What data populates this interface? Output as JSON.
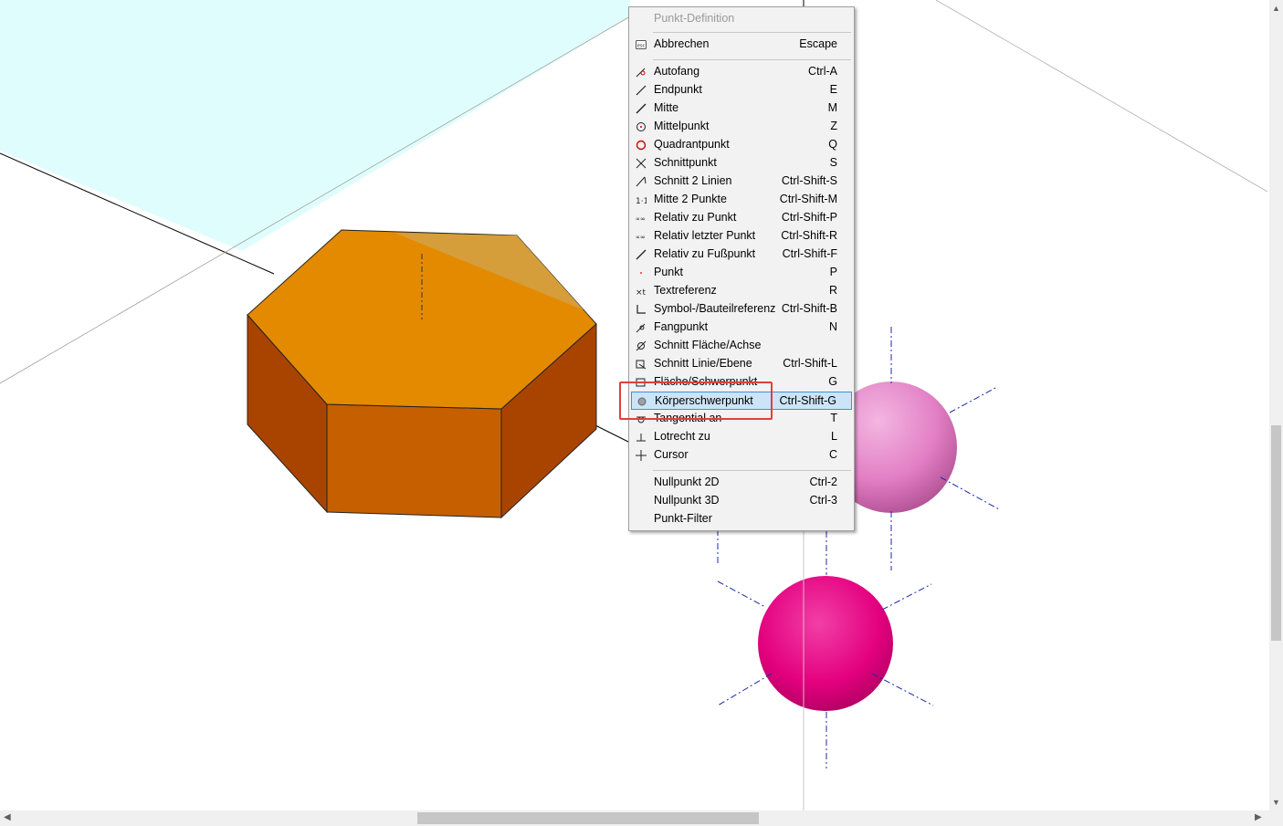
{
  "menu": {
    "header": "Punkt-Definition",
    "items": [
      {
        "label": "Abbrechen",
        "shortcut": "Escape",
        "icon": "esc-icon"
      },
      {
        "label": "Autofang",
        "shortcut": "Ctrl-A",
        "icon": "autosnap-icon"
      },
      {
        "label": "Endpunkt",
        "shortcut": "E",
        "icon": "endpoint-icon"
      },
      {
        "label": "Mitte",
        "shortcut": "M",
        "icon": "midpoint-icon"
      },
      {
        "label": "Mittelpunkt",
        "shortcut": "Z",
        "icon": "center-icon"
      },
      {
        "label": "Quadrantpunkt",
        "shortcut": "Q",
        "icon": "quadrant-icon"
      },
      {
        "label": "Schnittpunkt",
        "shortcut": "S",
        "icon": "intersection-icon"
      },
      {
        "label": "Schnitt 2 Linien",
        "shortcut": "Ctrl-Shift-S",
        "icon": "intersect-two-lines-icon"
      },
      {
        "label": "Mitte 2 Punkte",
        "shortcut": "Ctrl-Shift-M",
        "icon": "mid-two-points-icon"
      },
      {
        "label": "Relativ zu Punkt",
        "shortcut": "Ctrl-Shift-P",
        "icon": "relative-point-icon"
      },
      {
        "label": "Relativ letzter Punkt",
        "shortcut": "Ctrl-Shift-R",
        "icon": "relative-last-point-icon"
      },
      {
        "label": "Relativ zu Fußpunkt",
        "shortcut": "Ctrl-Shift-F",
        "icon": "relative-foot-point-icon"
      },
      {
        "label": "Punkt",
        "shortcut": "P",
        "icon": "point-icon"
      },
      {
        "label": "Textreferenz",
        "shortcut": "R",
        "icon": "text-reference-icon"
      },
      {
        "label": "Symbol-/Bauteilreferenz",
        "shortcut": "Ctrl-Shift-B",
        "icon": "symbol-reference-icon"
      },
      {
        "label": "Fangpunkt",
        "shortcut": "N",
        "icon": "snap-point-icon"
      },
      {
        "label": "Schnitt Fläche/Achse",
        "shortcut": "",
        "icon": "face-axis-intersection-icon"
      },
      {
        "label": "Schnitt Linie/Ebene",
        "shortcut": "Ctrl-Shift-L",
        "icon": "line-plane-intersection-icon"
      },
      {
        "label": "Fläche/Schwerpunkt",
        "shortcut": "G",
        "icon": "face-centroid-icon"
      },
      {
        "label": "Körperschwerpunkt",
        "shortcut": "Ctrl-Shift-G",
        "icon": "solid-centroid-icon",
        "highlighted": true
      },
      {
        "label": "Tangential an",
        "shortcut": "T",
        "icon": "tangent-icon"
      },
      {
        "label": "Lotrecht zu",
        "shortcut": "L",
        "icon": "perpendicular-icon"
      },
      {
        "label": "Cursor",
        "shortcut": "C",
        "icon": "cursor-icon"
      },
      {
        "label": "Nullpunkt 2D",
        "shortcut": "Ctrl-2",
        "icon": ""
      },
      {
        "label": "Nullpunkt 3D",
        "shortcut": "Ctrl-3",
        "icon": ""
      },
      {
        "label": "Punkt-Filter",
        "shortcut": "",
        "icon": ""
      }
    ]
  },
  "colors": {
    "ground_plane": "#e0fdfd",
    "hexagon_top": "#e38a00",
    "hexagon_front": "#c55f00",
    "hexagon_side": "#a94400",
    "sphere_pink": "#e27fc4",
    "sphere_magenta": "#e3007e",
    "highlight_border": "#e0403a",
    "menu_highlight": "#cce4f7"
  },
  "scrollbars": {
    "up_arrow": "▲",
    "down_arrow": "▼",
    "left_arrow": "◀",
    "right_arrow": "▶"
  }
}
